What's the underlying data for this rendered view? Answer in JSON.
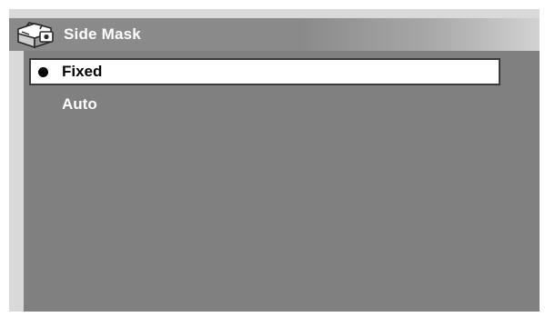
{
  "menu": {
    "title": "Side Mask",
    "title_icon": "toolbox-icon",
    "options": [
      {
        "label": "Fixed",
        "selected": true
      },
      {
        "label": "Auto",
        "selected": false
      }
    ]
  },
  "colors": {
    "background": "#d9d9d9",
    "panel": "#808080",
    "title_bar": "#8a8a8a",
    "selection": "#ffffff",
    "text": "#ffffff",
    "selected_text": "#000000"
  }
}
